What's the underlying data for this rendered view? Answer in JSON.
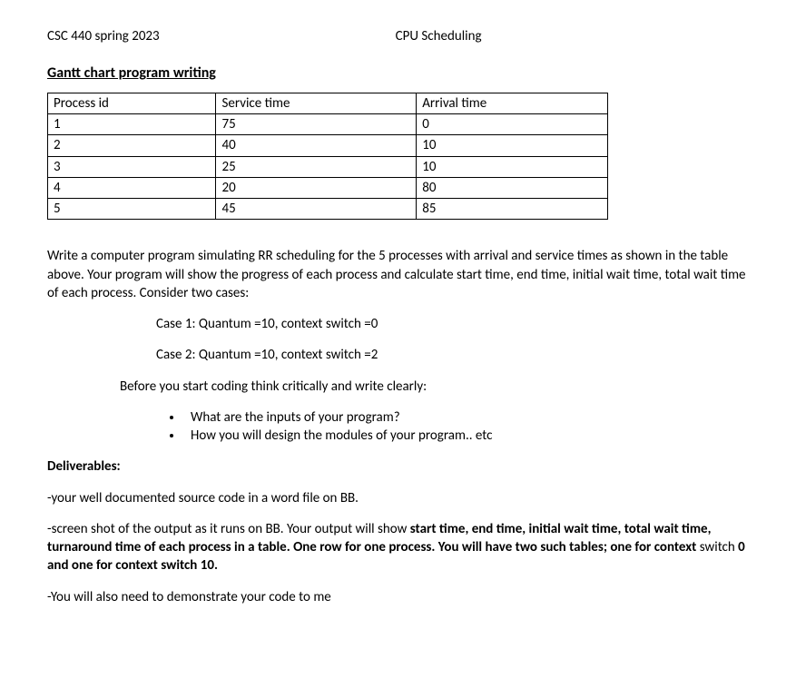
{
  "header": {
    "course": "CSC 440    spring 2023",
    "subject": "CPU  Scheduling"
  },
  "title": "Gantt chart program writing",
  "table": {
    "headers": [
      "Process id",
      "Service time",
      "Arrival time"
    ],
    "rows": [
      [
        "1",
        "75",
        "0"
      ],
      [
        "2",
        "40",
        "10"
      ],
      [
        "3",
        "25",
        "10"
      ],
      [
        "4",
        "20",
        "80"
      ],
      [
        "5",
        "45",
        "85"
      ]
    ]
  },
  "intro": "Write a computer program simulating RR scheduling for the 5 processes with arrival and service times as shown in the table above. Your program will show the progress of each process and calculate start time, end time, initial wait time, total wait time of each process. Consider two cases:",
  "case1": "Case 1:  Quantum =10,  context switch =0",
  "case2": "Case 2:  Quantum =10,  context switch =2",
  "think_preamble": "Before you start coding think critically and write clearly:",
  "bullets": [
    "What are the inputs of your program?",
    "How you will design the modules of your program.. etc"
  ],
  "deliverables_label": "Deliverables:",
  "deliv1": "-your well documented source code in a word file on BB.",
  "deliv2_a": "-screen shot of the output as it runs on BB. Your output will show ",
  "deliv2_bold1": "start time, end time, initial wait time, total wait time, turnaround time of each process in a table. One row for one process. You will have two such tables; one for context ",
  "deliv2_mid": "switch ",
  "deliv2_bold2": "0 and one for context switch 10.",
  "deliv3": "-You will also need to demonstrate your code to me"
}
